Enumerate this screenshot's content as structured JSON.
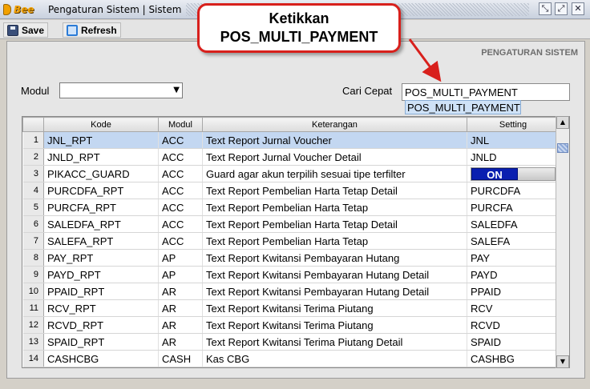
{
  "window": {
    "logo_text": "Bee",
    "title": "Pengaturan Sistem | Sistem",
    "controls": [
      "⤡",
      "⤢",
      "✕"
    ]
  },
  "toolbar": {
    "save_label": "Save",
    "refresh_label": "Refresh"
  },
  "panel": {
    "title": "PENGATURAN SISTEM",
    "modul_label": "Modul",
    "modul_value": "",
    "search_label": "Cari Cepat",
    "search_value": "POS_MULTI_PAYMENT",
    "suggestion": "POS_MULTI_PAYMENT"
  },
  "callout": {
    "line1": "Ketikkan",
    "line2": "POS_MULTI_PAYMENT"
  },
  "table": {
    "headers": [
      "Kode",
      "Modul",
      "Keterangan",
      "Setting"
    ],
    "rows": [
      {
        "no": "1",
        "kode": "JNL_RPT",
        "modul": "ACC",
        "ket": "Text Report Jurnal Voucher",
        "setting": "JNL"
      },
      {
        "no": "2",
        "kode": "JNLD_RPT",
        "modul": "ACC",
        "ket": "Text Report Jurnal Voucher Detail",
        "setting": "JNLD"
      },
      {
        "no": "3",
        "kode": "PIKACC_GUARD",
        "modul": "ACC",
        "ket": "Guard agar akun terpilih sesuai tipe terfilter",
        "setting": "ON"
      },
      {
        "no": "4",
        "kode": "PURCDFA_RPT",
        "modul": "ACC",
        "ket": "Text Report Pembelian Harta Tetap Detail",
        "setting": "PURCDFA"
      },
      {
        "no": "5",
        "kode": "PURCFA_RPT",
        "modul": "ACC",
        "ket": "Text Report Pembelian Harta Tetap",
        "setting": "PURCFA"
      },
      {
        "no": "6",
        "kode": "SALEDFA_RPT",
        "modul": "ACC",
        "ket": "Text Report Pembelian Harta Tetap Detail",
        "setting": "SALEDFA"
      },
      {
        "no": "7",
        "kode": "SALEFA_RPT",
        "modul": "ACC",
        "ket": "Text Report Pembelian Harta Tetap",
        "setting": "SALEFA"
      },
      {
        "no": "8",
        "kode": "PAY_RPT",
        "modul": "AP",
        "ket": "Text Report Kwitansi Pembayaran Hutang",
        "setting": "PAY"
      },
      {
        "no": "9",
        "kode": "PAYD_RPT",
        "modul": "AP",
        "ket": "Text Report Kwitansi Pembayaran Hutang Detail",
        "setting": "PAYD"
      },
      {
        "no": "10",
        "kode": "PPAID_RPT",
        "modul": "AR",
        "ket": "Text Report Kwitansi Pembayaran Hutang Detail",
        "setting": "PPAID"
      },
      {
        "no": "11",
        "kode": "RCV_RPT",
        "modul": "AR",
        "ket": "Text Report Kwitansi Terima Piutang",
        "setting": "RCV"
      },
      {
        "no": "12",
        "kode": "RCVD_RPT",
        "modul": "AR",
        "ket": "Text Report Kwitansi Terima Piutang",
        "setting": "RCVD"
      },
      {
        "no": "13",
        "kode": "SPAID_RPT",
        "modul": "AR",
        "ket": "Text Report Kwitansi Terima Piutang Detail",
        "setting": "SPAID"
      },
      {
        "no": "14",
        "kode": "CASHCBG",
        "modul": "CASH",
        "ket": "Kas CBG",
        "setting": "CASHBG"
      }
    ]
  },
  "colors": {
    "accent": "#d8201c",
    "selected_row": "#c3d7f1",
    "toggle_on": "#0a1fb0"
  }
}
